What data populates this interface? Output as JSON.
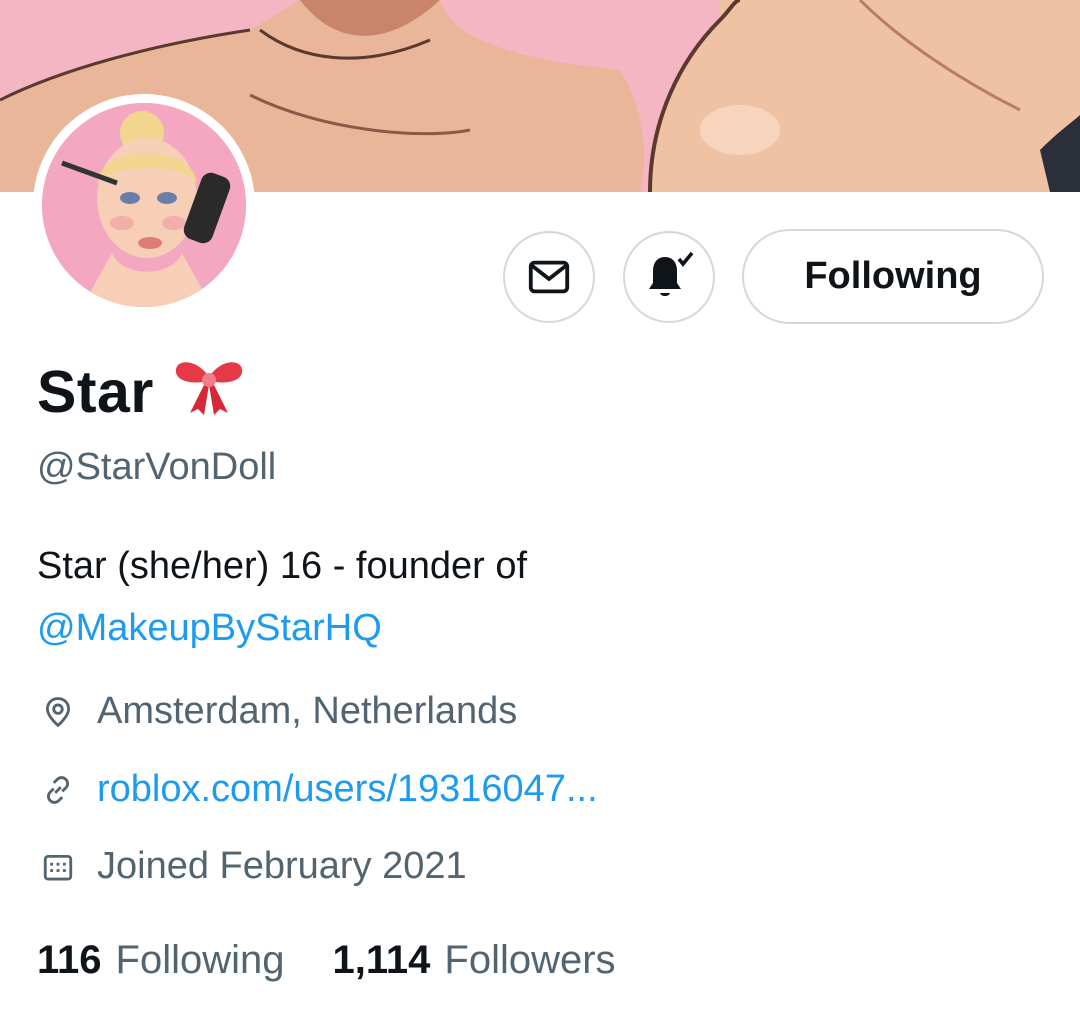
{
  "profile": {
    "name": "Star",
    "name_emoji": "🎀",
    "handle": "@StarVonDoll",
    "bio_text": "Star (she/her) 16 - founder of",
    "bio_mention": "@MakeupByStarHQ",
    "location": "Amsterdam, Netherlands",
    "website": "roblox.com/users/19316047...",
    "joined": "Joined February 2021"
  },
  "actions": {
    "message_icon": "envelope-icon",
    "notify_icon": "bell-check-icon",
    "follow_label": "Following"
  },
  "stats": {
    "following_count": "116",
    "following_label": "Following",
    "followers_count": "1,114",
    "followers_label": "Followers"
  },
  "colors": {
    "link": "#1d9bf0",
    "secondary_text": "#536471",
    "border": "#cfd9de",
    "banner_bg": "#f4b6c2"
  }
}
